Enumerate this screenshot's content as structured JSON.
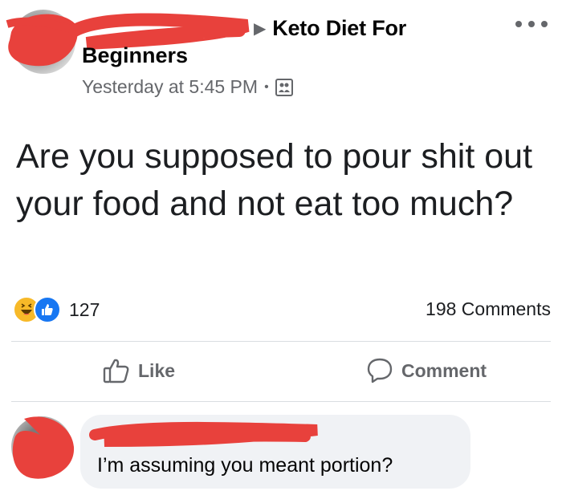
{
  "post": {
    "group_name_line1": "Keto Diet For",
    "group_name_line2": "Beginners",
    "timestamp": "Yesterday at 5:45 PM",
    "separator": "•",
    "privacy_icon": "group-privacy-icon",
    "text": "Are you supposed to pour shit out your food and not eat too much?"
  },
  "stats": {
    "reaction_icons": [
      "haha-icon",
      "like-icon"
    ],
    "reaction_count": "127",
    "comments_label": "198 Comments"
  },
  "actions": {
    "like_label": "Like",
    "comment_label": "Comment"
  },
  "comment": {
    "text": "I’m assuming you meant portion?"
  },
  "colors": {
    "redaction": "#e8413c",
    "secondary_text": "#65676b",
    "divider": "#dadde1",
    "bubble": "#f0f2f5",
    "like_blue": "#1877f2",
    "haha_yellow": "#f7b928"
  }
}
